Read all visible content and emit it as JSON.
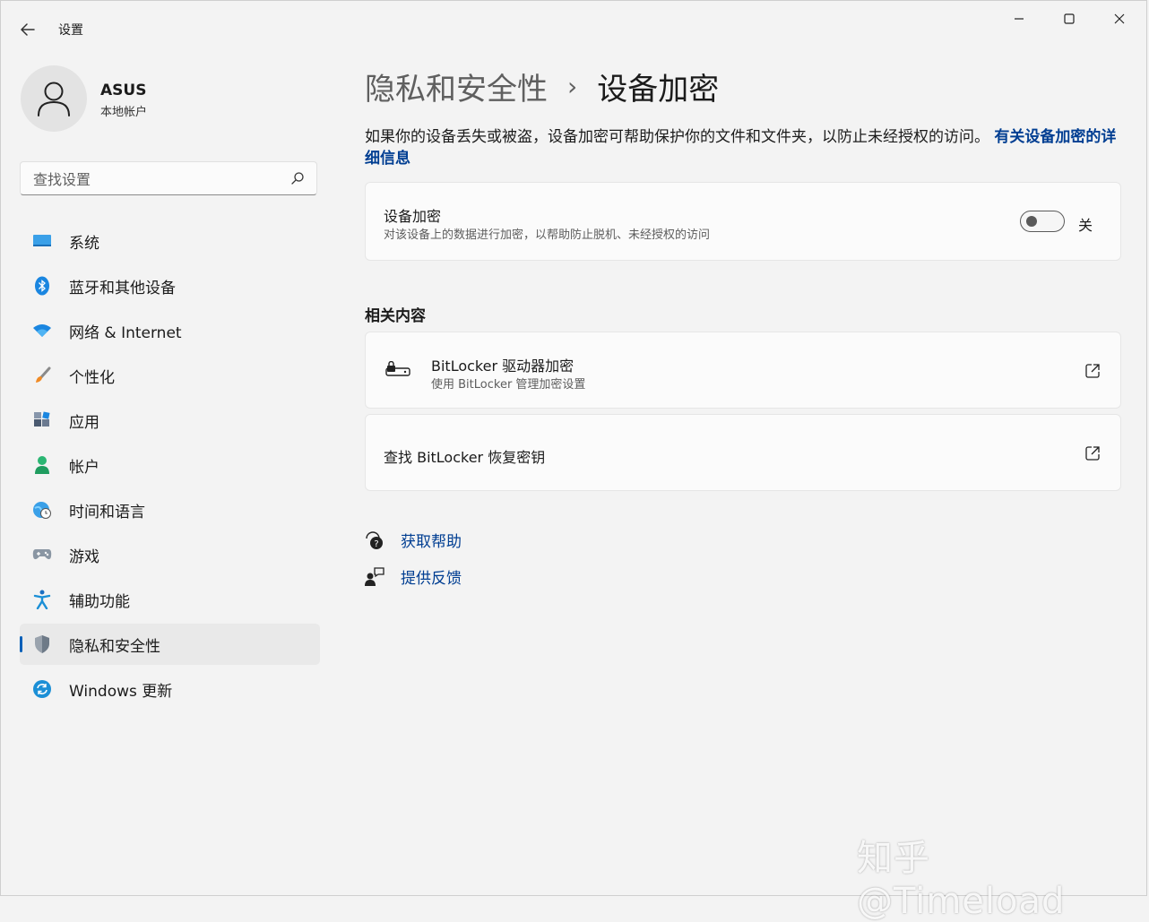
{
  "window": {
    "title": "设置",
    "controls": {
      "minimize": "─",
      "maximize": "☐",
      "close": "✕"
    }
  },
  "user": {
    "name": "ASUS",
    "account_type": "本地帐户"
  },
  "search": {
    "placeholder": "查找设置"
  },
  "sidebar": {
    "items": [
      {
        "label": "系统",
        "icon": "monitor-icon",
        "color": "#0078d4"
      },
      {
        "label": "蓝牙和其他设备",
        "icon": "bluetooth-icon",
        "color": "#0078d4"
      },
      {
        "label": "网络 & Internet",
        "icon": "wifi-icon",
        "color": "#0078d4"
      },
      {
        "label": "个性化",
        "icon": "brush-icon",
        "color": "#f08a24"
      },
      {
        "label": "应用",
        "icon": "apps-icon",
        "color": "#4a5a70"
      },
      {
        "label": "帐户",
        "icon": "person-icon",
        "color": "#2bb673"
      },
      {
        "label": "时间和语言",
        "icon": "globe-clock-icon",
        "color": "#2a8fd8"
      },
      {
        "label": "游戏",
        "icon": "gamepad-icon",
        "color": "#6b7785"
      },
      {
        "label": "辅助功能",
        "icon": "accessibility-icon",
        "color": "#1b8fd6"
      },
      {
        "label": "隐私和安全性",
        "icon": "shield-icon",
        "color": "#6e7a87",
        "active": true
      },
      {
        "label": "Windows 更新",
        "icon": "update-icon",
        "color": "#1b8fd6"
      }
    ]
  },
  "breadcrumb": {
    "parent": "隐私和安全性",
    "separator": "›",
    "current": "设备加密"
  },
  "description": {
    "text": "如果你的设备丢失或被盗，设备加密可帮助保护你的文件和文件夹，以防止未经授权的访问。",
    "link": "有关设备加密的详细信息"
  },
  "encryption": {
    "title": "设备加密",
    "subtitle": "对该设备上的数据进行加密，以帮助防止脱机、未经授权的访问",
    "toggle_state": "关",
    "enabled": false
  },
  "related": {
    "heading": "相关内容",
    "bitlocker": {
      "title": "BitLocker 驱动器加密",
      "subtitle": "使用 BitLocker 管理加密设置"
    },
    "recovery": {
      "title": "查找 BitLocker 恢复密钥"
    }
  },
  "help": {
    "get_help": "获取帮助",
    "feedback": "提供反馈"
  },
  "watermark": "知乎 @Timeload",
  "accent_color": "#005fb8",
  "link_color": "#003e92"
}
